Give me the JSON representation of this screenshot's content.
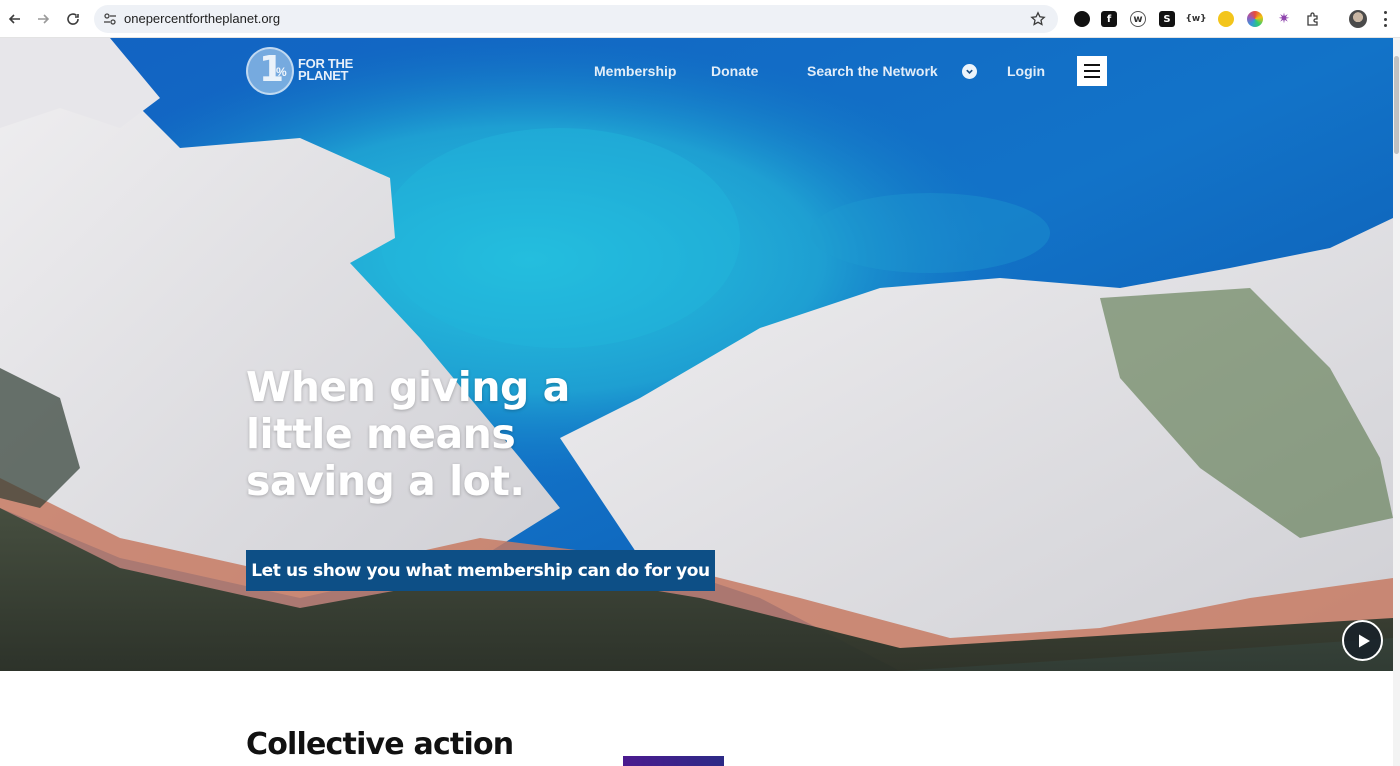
{
  "browser": {
    "url": "onepercentfortheplanet.org"
  },
  "site": {
    "logo": {
      "numeral": "1",
      "percent": "%",
      "line1": "FOR THE",
      "line2": "PLANET"
    },
    "nav": {
      "membership": "Membership",
      "donate": "Donate",
      "search_network": "Search the Network",
      "login": "Login"
    }
  },
  "hero": {
    "headline_line1": "When giving a",
    "headline_line2": "little means",
    "headline_line3": "saving a lot.",
    "cta_label": "Let us show you what membership can do for you"
  },
  "section": {
    "title": "Collective action"
  }
}
